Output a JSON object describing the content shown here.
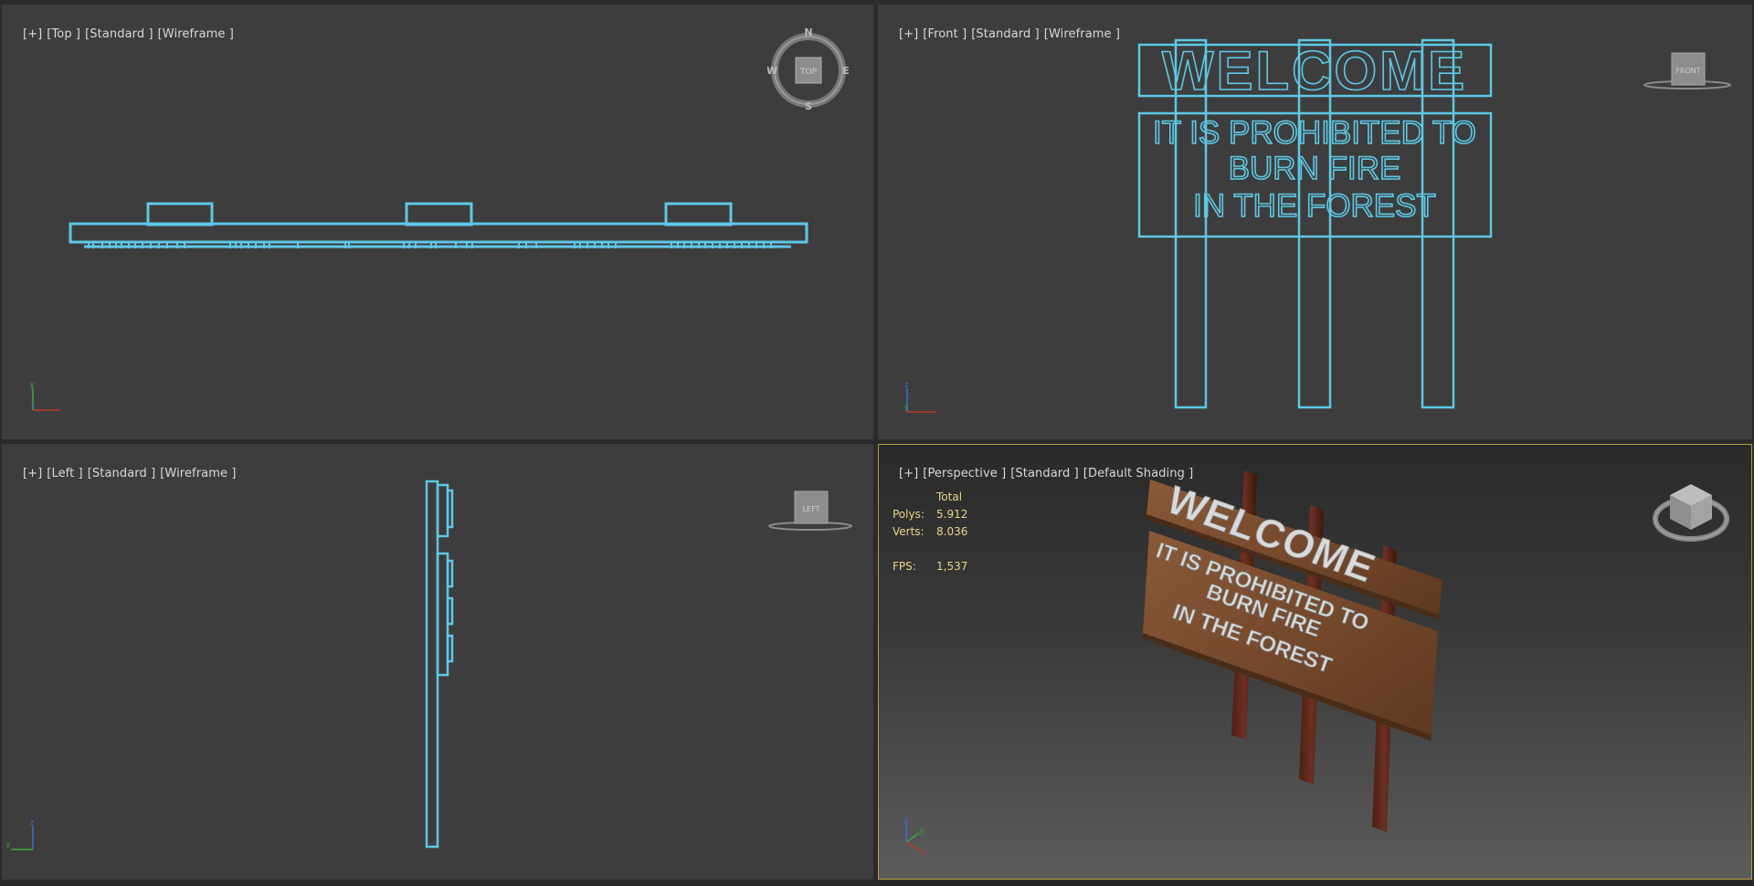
{
  "viewports": {
    "top": {
      "labels": [
        "[+]",
        "[Top ]",
        "[Standard ]",
        "[Wireframe ]"
      ],
      "viewcube_face": "TOP",
      "compass": {
        "n": "N",
        "s": "S",
        "e": "E",
        "w": "W"
      },
      "axis": {
        "a": "y",
        "b": "x"
      }
    },
    "front": {
      "labels": [
        "[+]",
        "[Front ]",
        "[Standard ]",
        "[Wireframe ]"
      ],
      "viewcube_face": "FRONT",
      "axis": {
        "a": "z",
        "b": "x"
      }
    },
    "left": {
      "labels": [
        "[+]",
        "[Left ]",
        "[Standard ]",
        "[Wireframe ]"
      ],
      "viewcube_face": "LEFT",
      "axis": {
        "a": "z",
        "b": "y"
      }
    },
    "perspective": {
      "labels": [
        "[+]",
        "[Perspective ]",
        "[Standard ]",
        "[Default Shading ]"
      ],
      "axis": {
        "a": "z",
        "b": "y",
        "c": "x"
      },
      "stats": {
        "header": "Total",
        "polys_label": "Polys:",
        "polys_value": "5.912",
        "verts_label": "Verts:",
        "verts_value": "8.036",
        "fps_label": "FPS:",
        "fps_value": "1,537"
      }
    }
  },
  "sign": {
    "title": "WELCOME",
    "line1": "IT IS PROHIBITED TO",
    "line2": "BURN FIRE",
    "line3": "IN THE FOREST"
  },
  "colors": {
    "wire": "#5ec8e6",
    "viewport_bg": "#3d3d3d",
    "active_border": "#b49a3c",
    "stats_text": "#e6d68a",
    "wood": "#7a4a2c"
  }
}
